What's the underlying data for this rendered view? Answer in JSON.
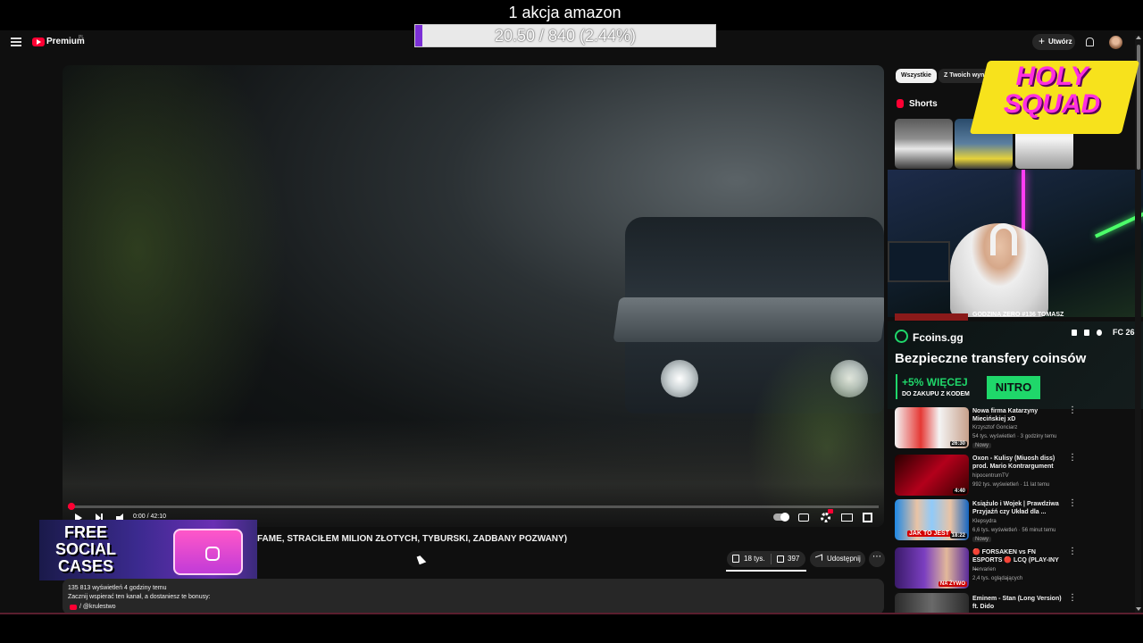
{
  "stream_overlay": {
    "goal_title": "1 akcja amazon",
    "goal_progress": "20.50 / 840 (2.44%)",
    "goal_fraction": 0.0244,
    "bar_color": "#7b2fd6",
    "brand_logo": "HOLY SQUAD",
    "brand_color": "#ff2ee0"
  },
  "header": {
    "logo": "Premium",
    "logo_region": "PL",
    "create_label": "Utwórz"
  },
  "player": {
    "time": "0:00 / 42:10",
    "progress_fraction": 0.0
  },
  "video": {
    "title": "FAME, STRACIŁEM MILION ZŁOTYCH, TYBURSKI, ZADBANY POZWANY)",
    "likes": "18 tys.",
    "dislikes": "397",
    "share_label": "Udostępnij",
    "more_label": "⋯",
    "views_line": "135 813 wyświetleń  4 godziny temu",
    "desc_line": "Zacznij wspierać ten kanał, a dostaniesz te bonusy:",
    "desc_link": "/ @krulestwo"
  },
  "promo_overlay": {
    "text": "FREE SOCIAL CASES"
  },
  "sidebar": {
    "chips": [
      "Wszystkie",
      "Z Twoich wyników wyszuk"
    ],
    "shorts_label": "Shorts",
    "cam_caption": "GODZINA ZERO #136 TOMASZ"
  },
  "ad": {
    "brand": "Fcoins.gg",
    "platform": "FC 26",
    "headline": "Bezpieczne transfery coinsów",
    "bonus": "+5% WIĘCEJ",
    "bonus_sub": "DO ZAKUPU Z KODEM",
    "code": "NITRO",
    "accent": "#1fd76a"
  },
  "recommendations": [
    {
      "title": "Nowa firma Katarzyny Miecińskiej xD",
      "channel": "Krzysztof Gonciarz",
      "meta": "54 tys. wyświetleń · 3 godziny temu",
      "badge": "Nowy",
      "duration": "26:30"
    },
    {
      "title": "Oxon - Kulisy (Miuosh diss) prod. Mario Kontrargument",
      "channel": "hipocentrumTV",
      "meta": "992 tys. wyświetleń · 11 lat temu",
      "duration": "4:40"
    },
    {
      "title": "Książulo i Wojek | Prawdziwa Przyjaźń czy Układ dla ...",
      "channel": "Klepsydra",
      "meta": "6,6 tys. wyświetleń · 56 minut temu",
      "badge": "Nowy",
      "duration": "18:22",
      "thumb_text": "JAK TO JEST"
    },
    {
      "title": "🔴 FORSAKEN vs FN ESPORTS 🔴 LCQ (PLAY-INY ...",
      "channel": "Nervarien",
      "meta": "2,4 tys. oglądających",
      "live": "NA ŻYWO"
    },
    {
      "title": "Eminem - Stan (Long Version) ft. Dido",
      "channel": "",
      "meta": ""
    }
  ]
}
